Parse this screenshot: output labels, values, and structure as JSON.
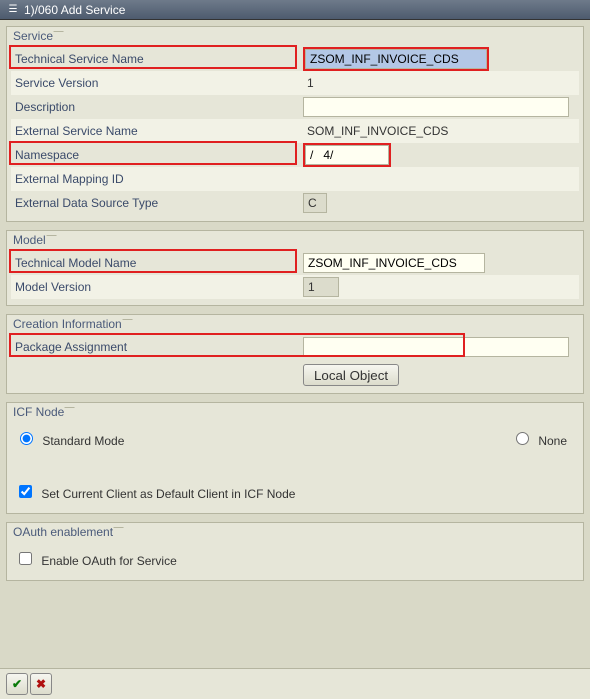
{
  "window": {
    "title": "  1)/060 Add Service"
  },
  "service": {
    "group_title": "Service",
    "tech_name_label": "Technical Service Name",
    "tech_name_value": "ZSOM_INF_INVOICE_CDS",
    "version_label": "Service Version",
    "version_value": "1",
    "description_label": "Description",
    "description_value": "",
    "ext_name_label": "External Service Name",
    "ext_name_value": "SOM_INF_INVOICE_CDS",
    "namespace_label": "Namespace",
    "namespace_value": "/   4/",
    "ext_mapping_label": "External Mapping ID",
    "ext_mapping_value": "",
    "ext_data_src_label": "External Data Source Type",
    "ext_data_src_value": "C"
  },
  "model": {
    "group_title": "Model",
    "tech_name_label": "Technical Model Name",
    "tech_name_value": "ZSOM_INF_INVOICE_CDS",
    "version_label": "Model Version",
    "version_value": "1"
  },
  "creation": {
    "group_title": "Creation Information",
    "package_label": "Package Assignment",
    "package_value": "",
    "local_object_label": "Local Object"
  },
  "icf": {
    "group_title": "ICF Node",
    "standard_label": "Standard Mode",
    "none_label": "None",
    "default_client_label": "Set Current Client as Default Client in ICF Node"
  },
  "oauth": {
    "group_title": "OAuth enablement",
    "enable_label": "Enable OAuth for Service"
  }
}
